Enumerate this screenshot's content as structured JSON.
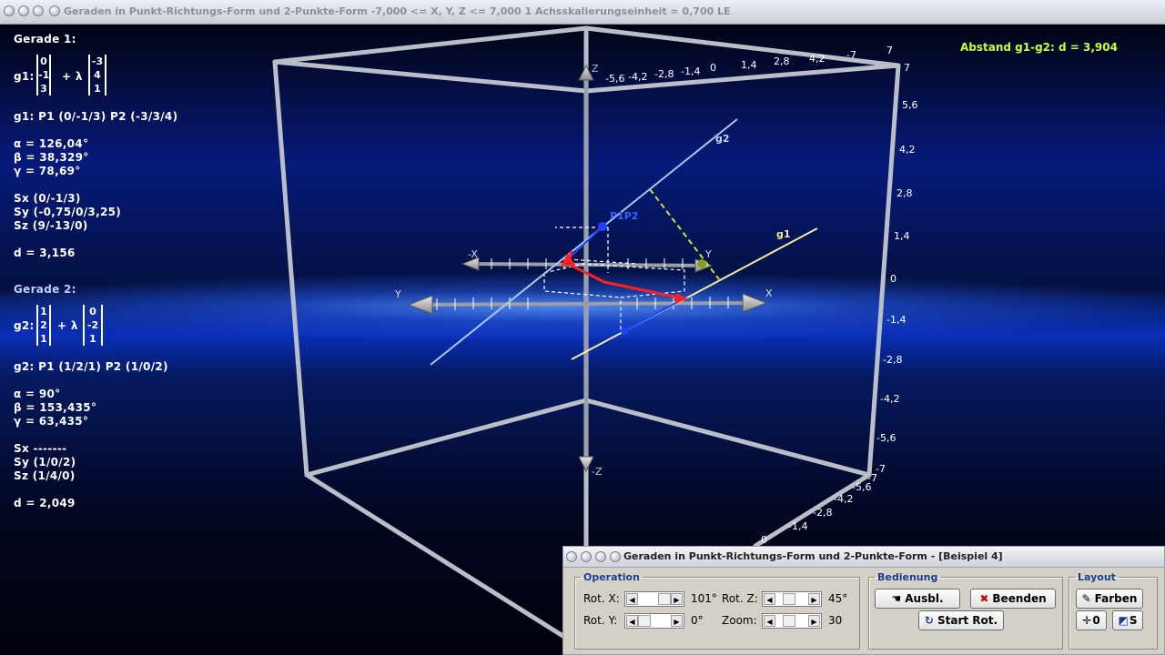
{
  "window": {
    "title": "Geraden in Punkt-Richtungs-Form und 2-Punkte-Form   -7,000 <= X, Y, Z <= 7,000    1 Achsskalierungseinheit = 0,700 LE"
  },
  "info": {
    "g1": {
      "heading": "Gerade 1:",
      "label": "g1:",
      "point": [
        "0",
        "-1",
        "3"
      ],
      "direction": [
        "-3",
        "4",
        "1"
      ],
      "plus_lambda": "+ λ",
      "points": "g1: P1 (0/-1/3)    P2 (-3/3/4)",
      "alpha": "α = 126,04°",
      "beta": "β = 38,329°",
      "gamma": "γ = 78,69°",
      "sx": "Sx (0/-1/3)",
      "sy": "Sy (-0,75/0/3,25)",
      "sz": "Sz (9/-13/0)",
      "d": "d = 3,156"
    },
    "g2": {
      "heading": "Gerade 2:",
      "label": "g2:",
      "point": [
        "1",
        "2",
        "1"
      ],
      "direction": [
        "0",
        "-2",
        "1"
      ],
      "plus_lambda": "+ λ",
      "points": "g2: P1 (1/2/1)    P2 (1/0/2)",
      "alpha": "α = 90°",
      "beta": "β = 153,435°",
      "gamma": "γ = 63,435°",
      "sx": "Sx -------",
      "sy": "Sy (1/0/2)",
      "sz": "Sz (1/4/0)",
      "d": "d = 2,049"
    },
    "distance": "Abstand g1-g2: d = 3,904"
  },
  "scene": {
    "z_axis_label": "Z",
    "z_axis_neg_label": "-Z",
    "x_axis_label": "X",
    "x_axis_neg_label": "-X",
    "y_axis_label": "Y",
    "y_axis_neg_label": "Y",
    "line_g1_label": "g1",
    "line_g2_label": "g2",
    "point_label": "P1P2",
    "top_ticks": [
      "-5,6",
      "-4,2",
      "-2,8",
      "-1,4",
      "0",
      "1,4",
      "2,8",
      "4,2",
      "-7",
      "7"
    ],
    "right_ticks": [
      "7",
      "5,6",
      "4,2",
      "2,8",
      "1,4",
      "0",
      "-1,4",
      "-2,8",
      "-4,2",
      "-5,6",
      "-7"
    ],
    "bottom_ticks": [
      "-7",
      "-5,6",
      "-4,2",
      "-2,8",
      "-1,4",
      "0"
    ],
    "colors": {
      "g1": "#f5f0a0",
      "g2": "#a8c8f0",
      "distance_segment": "#c8e040",
      "accent_red": "#ff2020",
      "point": "#2040ff"
    }
  },
  "panel": {
    "title": "Geraden in Punkt-Richtungs-Form und 2-Punkte-Form - [Beispiel 4]",
    "operation": {
      "legend": "Operation",
      "rot_x_label": "Rot. X:",
      "rot_x_value": "101°",
      "rot_y_label": "Rot. Y:",
      "rot_y_value": "0°",
      "rot_z_label": "Rot. Z:",
      "rot_z_value": "45°",
      "zoom_label": "Zoom:",
      "zoom_value": "30"
    },
    "bedienung": {
      "legend": "Bedienung",
      "ausbl_label": "Ausbl.",
      "beenden_label": "Beenden",
      "start_rot_label": "Start Rot."
    },
    "layout": {
      "legend": "Layout",
      "farben_label": "Farben",
      "zero_label": "0",
      "s_label": "S"
    }
  }
}
